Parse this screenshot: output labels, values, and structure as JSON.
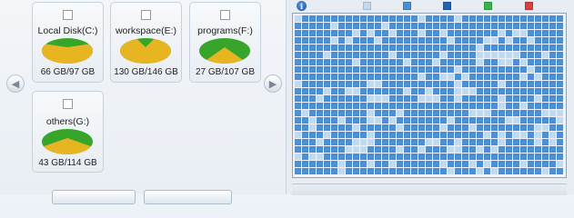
{
  "drives": [
    {
      "id": "c",
      "name": "Local Disk(C:)",
      "usage": "66 GB/97 GB",
      "used_fraction": 0.68,
      "checked": false
    },
    {
      "id": "e",
      "name": "workspace(E:)",
      "usage": "130 GB/146 GB",
      "used_fraction": 0.89,
      "checked": false
    },
    {
      "id": "f",
      "name": "programs(F:)",
      "usage": "27 GB/107 GB",
      "used_fraction": 0.25,
      "checked": false
    },
    {
      "id": "g",
      "name": "others(G:)",
      "usage": "43 GB/114 GB",
      "used_fraction": 0.38,
      "checked": false
    }
  ],
  "legend": {
    "info_icon": "info-icon",
    "swatches": [
      {
        "name": "free-space-swatch",
        "color": "#c3d9ee"
      },
      {
        "name": "used-space-swatch",
        "color": "#4a90d2"
      },
      {
        "name": "system-swatch",
        "color": "#1f63b0"
      },
      {
        "name": "optimized-swatch",
        "color": "#38b24a"
      },
      {
        "name": "fragmented-swatch",
        "color": "#d94040"
      }
    ]
  },
  "colors": {
    "pie_free": "#36a52a",
    "pie_used": "#e7b522",
    "cluster_used": "#4a90d2",
    "cluster_free": "#c3d9ee"
  }
}
